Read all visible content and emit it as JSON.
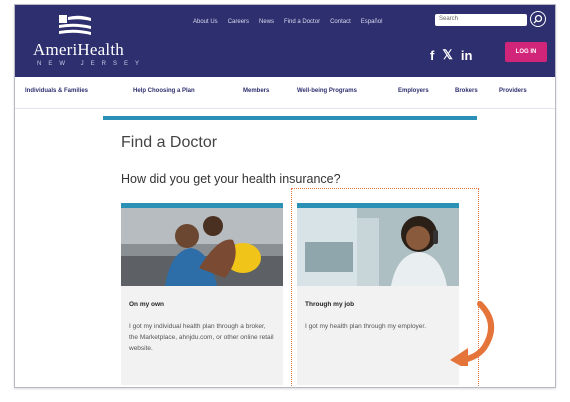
{
  "header": {
    "logo_name": "AmeriHealth",
    "logo_sub": "NEW JERSEY",
    "top_links": [
      "About Us",
      "Careers",
      "News",
      "Find a Doctor",
      "Contact",
      "Español"
    ],
    "search_placeholder": "Search",
    "social": [
      "f",
      "𝕏",
      "in"
    ],
    "login_label": "LOG IN"
  },
  "main_nav": [
    "Individuals & Families",
    "Help Choosing a Plan",
    "Members",
    "Well-being Programs",
    "Employers",
    "Brokers",
    "Providers"
  ],
  "page": {
    "title": "Find a Doctor",
    "question": "How did you get your health insurance?"
  },
  "cards": [
    {
      "title": "On my own",
      "description": "I got my individual health plan through a broker, the Marketplace, ahnjdu.com, or other online retail website."
    },
    {
      "title": "Through my job",
      "description": "I got my health plan through my employer."
    }
  ],
  "colors": {
    "header": "#2e2f6f",
    "accent": "#2b90b5",
    "login": "#d1257a",
    "highlight": "#e5743a"
  }
}
